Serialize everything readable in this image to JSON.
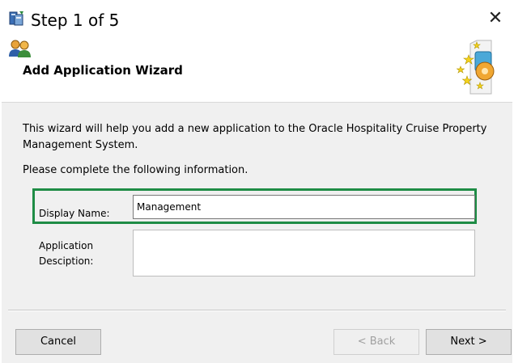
{
  "window": {
    "title": "Step 1 of 5",
    "close_glyph": "✕"
  },
  "header": {
    "title": "Add Application Wizard"
  },
  "intro": {
    "text": "This wizard will help you add a new application to the Oracle Hospitality Cruise Property Management System.",
    "instruction": "Please complete the following information."
  },
  "form": {
    "display_name_label": "Display Name:",
    "display_name_value": "Management",
    "description_label": "Application Desciption:",
    "description_value": ""
  },
  "buttons": {
    "cancel": "Cancel",
    "back": "< Back",
    "next": "Next >"
  },
  "colors": {
    "highlight": "#1e8c45",
    "disabled_text": "#a0a0a0"
  },
  "icons": {
    "title": "app-setup-icon",
    "header_left": "users-icon",
    "header_right": "wizard-stars-icon",
    "close": "close-icon"
  }
}
